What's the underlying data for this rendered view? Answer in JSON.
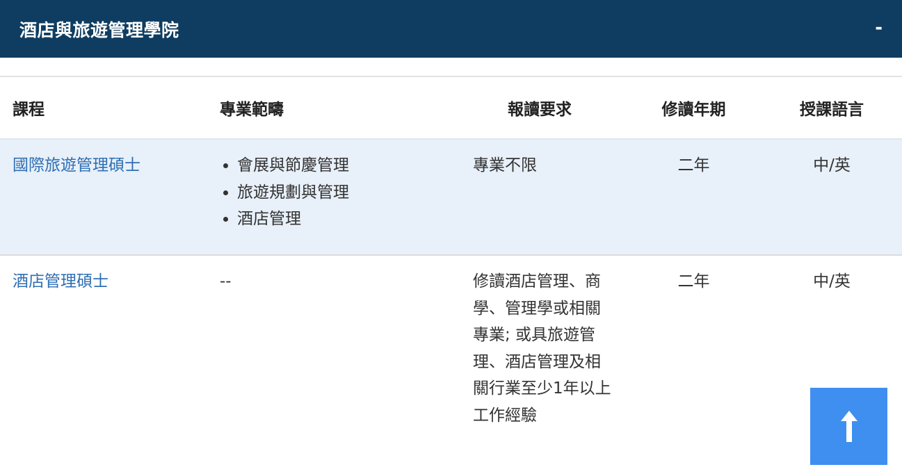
{
  "header": {
    "title": "酒店與旅遊管理學院",
    "toggle_label": "-"
  },
  "table": {
    "columns": [
      "課程",
      "專業範疇",
      "報讀要求",
      "修讀年期",
      "授課語言"
    ],
    "rows": [
      {
        "course": "國際旅遊管理碩士",
        "specializations": [
          "會展與節慶管理",
          "旅遊規劃與管理",
          "酒店管理"
        ],
        "requirements": "專業不限",
        "duration": "二年",
        "language": "中/英"
      },
      {
        "course": "酒店管理碩士",
        "specializations_text": "--",
        "requirements": "修讀酒店管理、商學、管理學或相關專業; 或具旅遊管理、酒店管理及相關行業至少1年以上工作經驗",
        "duration": "二年",
        "language": "中/英"
      }
    ]
  },
  "colors": {
    "header_bg": "#0f3d61",
    "row_highlight": "#e8f0f9",
    "link": "#2f6fb3",
    "back_to_top_bg": "#3f8ff0"
  },
  "icons": {
    "back_to_top": "arrow-up-icon"
  }
}
